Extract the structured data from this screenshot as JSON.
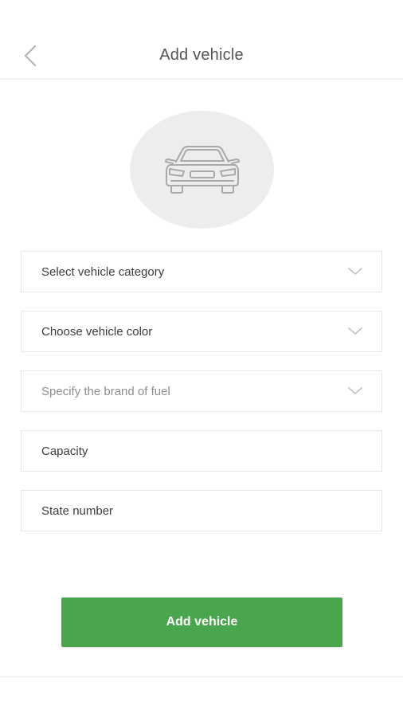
{
  "header": {
    "title": "Add vehicle",
    "back_icon": "chevron-left-icon"
  },
  "avatar": {
    "icon": "car-icon"
  },
  "form": {
    "category_select": {
      "value": "Select vehicle category",
      "icon": "chevron-down-icon"
    },
    "color_select": {
      "value": "Choose vehicle color",
      "icon": "chevron-down-icon"
    },
    "fuel_select": {
      "value": "Specify the brand of fuel",
      "icon": "chevron-down-icon"
    },
    "capacity_input": {
      "value": "Capacity"
    },
    "state_number_input": {
      "value": "State number"
    }
  },
  "actions": {
    "submit_label": "Add vehicle"
  },
  "colors": {
    "primary": "#4aa54f",
    "avatar_bg": "#ededed",
    "border": "#e6e6e6"
  }
}
